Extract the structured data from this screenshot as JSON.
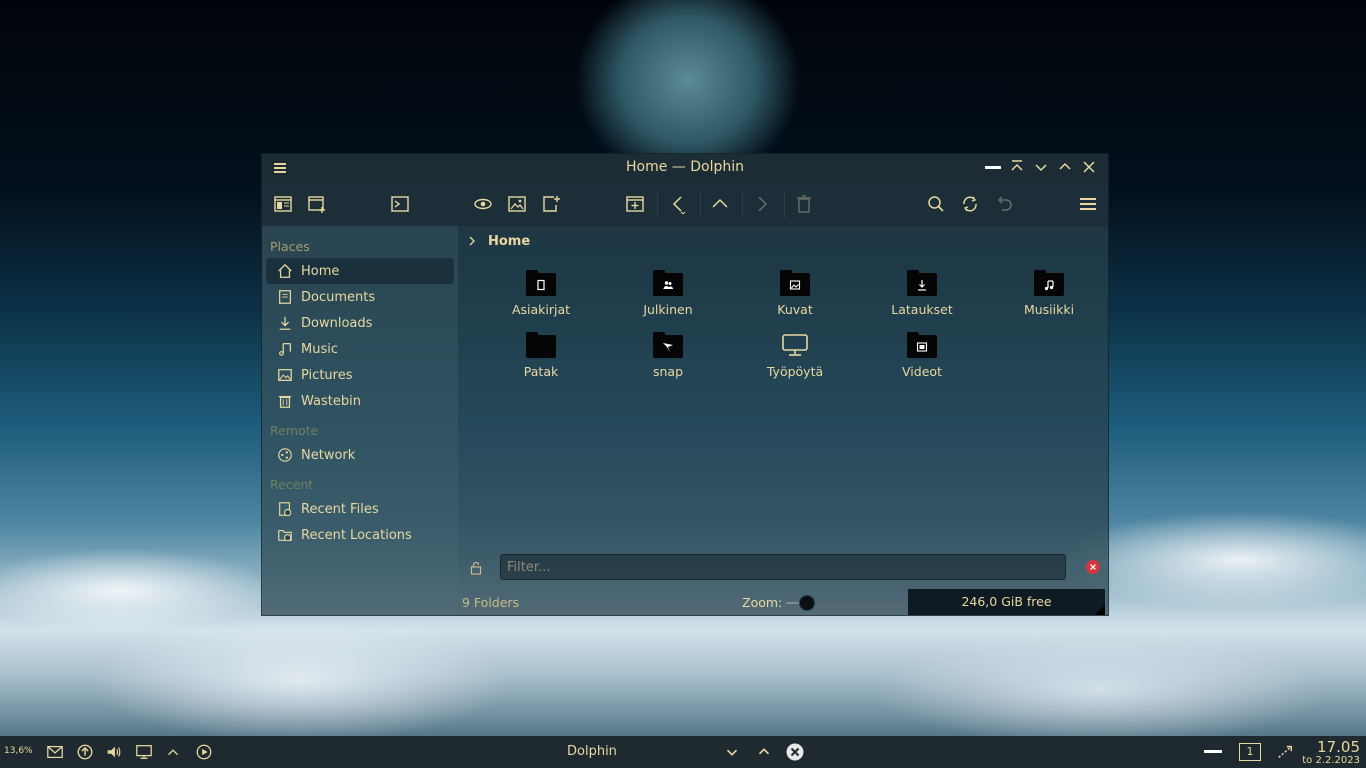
{
  "window": {
    "title": "Home — Dolphin"
  },
  "sidebar": {
    "places_title": "Places",
    "places": [
      {
        "label": "Home",
        "icon": "home-icon"
      },
      {
        "label": "Documents",
        "icon": "documents-icon"
      },
      {
        "label": "Downloads",
        "icon": "downloads-icon"
      },
      {
        "label": "Music",
        "icon": "music-icon"
      },
      {
        "label": "Pictures",
        "icon": "pictures-icon"
      },
      {
        "label": "Wastebin",
        "icon": "wastebin-icon"
      }
    ],
    "remote_title": "Remote",
    "remote": [
      {
        "label": "Network",
        "icon": "network-icon"
      }
    ],
    "recent_title": "Recent",
    "recent": [
      {
        "label": "Recent Files",
        "icon": "recent-files-icon"
      },
      {
        "label": "Recent Locations",
        "icon": "recent-locations-icon"
      }
    ]
  },
  "breadcrumb": {
    "current": "Home"
  },
  "folders": [
    {
      "label": "Asiakirjat",
      "icon": "document-folder-icon"
    },
    {
      "label": "Julkinen",
      "icon": "public-folder-icon"
    },
    {
      "label": "Kuvat",
      "icon": "pictures-folder-icon"
    },
    {
      "label": "Lataukset",
      "icon": "downloads-folder-icon"
    },
    {
      "label": "Musiikki",
      "icon": "music-folder-icon"
    },
    {
      "label": "Patak",
      "icon": "folder-icon"
    },
    {
      "label": "snap",
      "icon": "snap-folder-icon"
    },
    {
      "label": "Työpöytä",
      "icon": "desktop-icon"
    },
    {
      "label": "Videot",
      "icon": "videos-folder-icon"
    }
  ],
  "filter": {
    "placeholder": "Filter..."
  },
  "status": {
    "folder_count": "9 Folders",
    "zoom_label": "Zoom:",
    "zoom_level": 0.18,
    "free_space": "246,0 GiB free"
  },
  "taskbar": {
    "cpu": "13,6%",
    "active_app": "Dolphin",
    "desktop_number": "1",
    "time": "17.05",
    "date": "to 2.2.2023"
  },
  "colors": {
    "text": "#e8d8a0",
    "accent_close": "#d6363f"
  }
}
